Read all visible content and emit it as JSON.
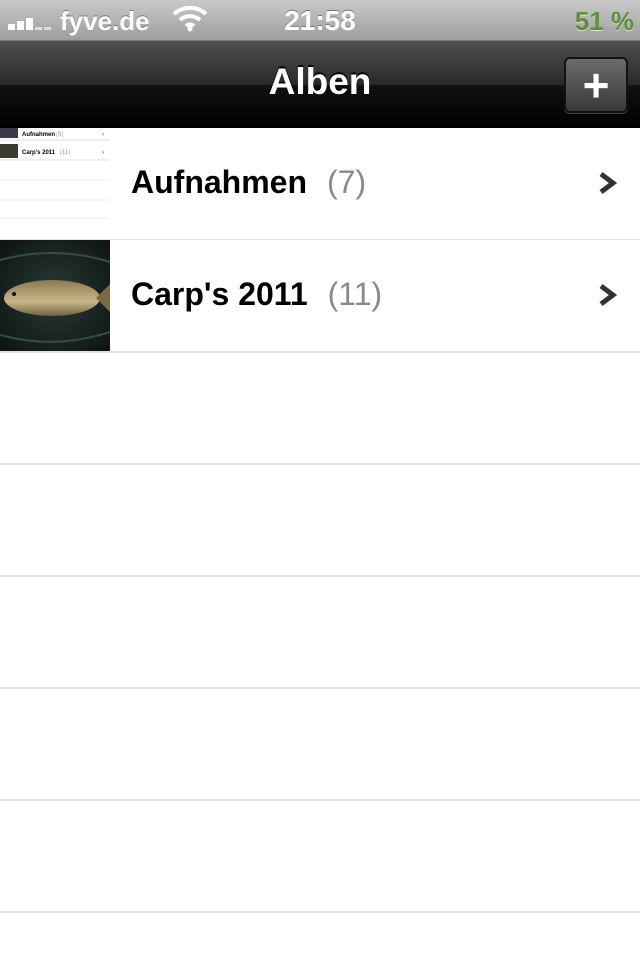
{
  "status_bar": {
    "carrier": "fyve.de",
    "time": "21:58",
    "battery": "51 %"
  },
  "nav": {
    "title": "Alben",
    "add_label": "+"
  },
  "albums": [
    {
      "name": "Aufnahmen",
      "count": "(7)"
    },
    {
      "name": "Carp's 2011",
      "count": "(11)"
    }
  ],
  "thumb_mini_rows": [
    {
      "name": "Aufnahmen",
      "count": "(5)"
    },
    {
      "name": "Carp's 2011",
      "count": "(11)"
    }
  ],
  "colors": {
    "navbar": "#1a1a1a",
    "separator": "#e0e0e0",
    "count_text": "#8a8a8a",
    "battery_text": "#5e8f3d"
  }
}
